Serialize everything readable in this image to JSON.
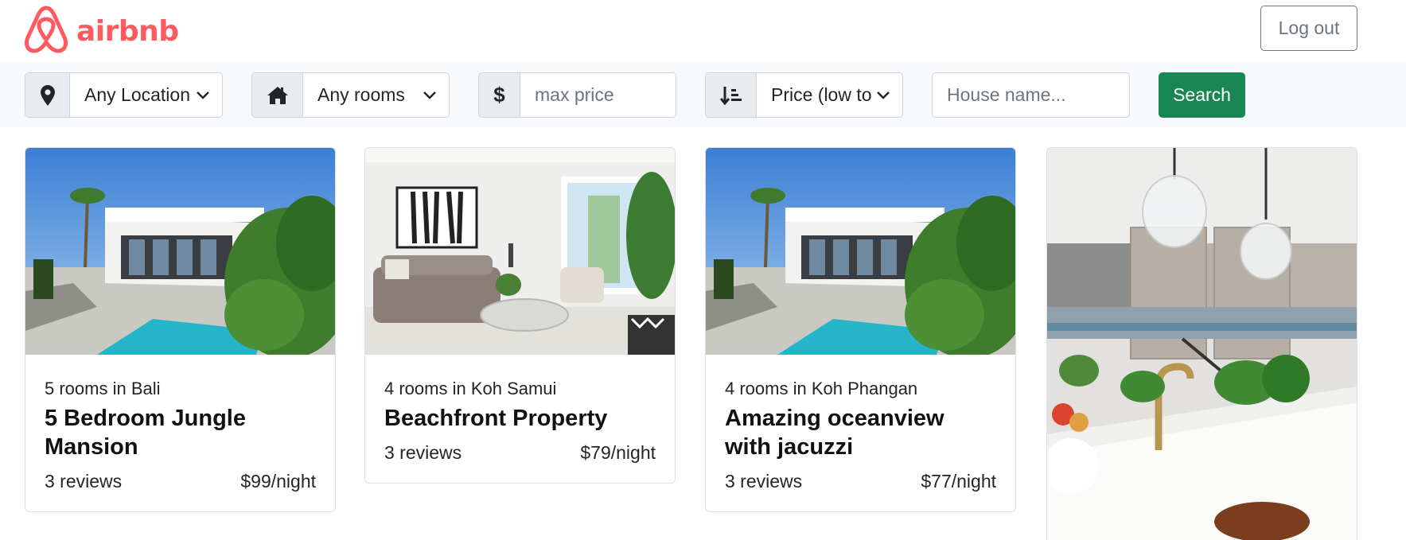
{
  "brand": {
    "name": "airbnb",
    "color": "#ff5a5f",
    "icon": "airbnb-logo-icon"
  },
  "header": {
    "logout_label": "Log out"
  },
  "filters": {
    "location": {
      "icon": "map-pin-icon",
      "value": "Any Location"
    },
    "rooms": {
      "icon": "home-icon",
      "value": "Any rooms"
    },
    "price": {
      "icon": "dollar-icon",
      "placeholder": "max price"
    },
    "sort": {
      "icon": "sort-ascending-icon",
      "value": "Price (low to high)"
    },
    "house_name": {
      "placeholder": "House name..."
    },
    "search_label": "Search",
    "search_color": "#198754"
  },
  "listings": [
    {
      "subtitle": "5 rooms in Bali",
      "title": "5 Bedroom Jungle Mansion",
      "reviews": "3 reviews",
      "price": "$99/night",
      "image": "villa-pool-photo"
    },
    {
      "subtitle": "4 rooms in Koh Samui",
      "title": "Beachfront Property",
      "reviews": "3 reviews",
      "price": "$79/night",
      "image": "living-room-photo"
    },
    {
      "subtitle": "4 rooms in Koh Phangan",
      "title": "Amazing oceanview with jacuzzi",
      "reviews": "3 reviews",
      "price": "$77/night",
      "image": "villa-pool-photo"
    },
    {
      "image": "kitchen-photo"
    }
  ]
}
